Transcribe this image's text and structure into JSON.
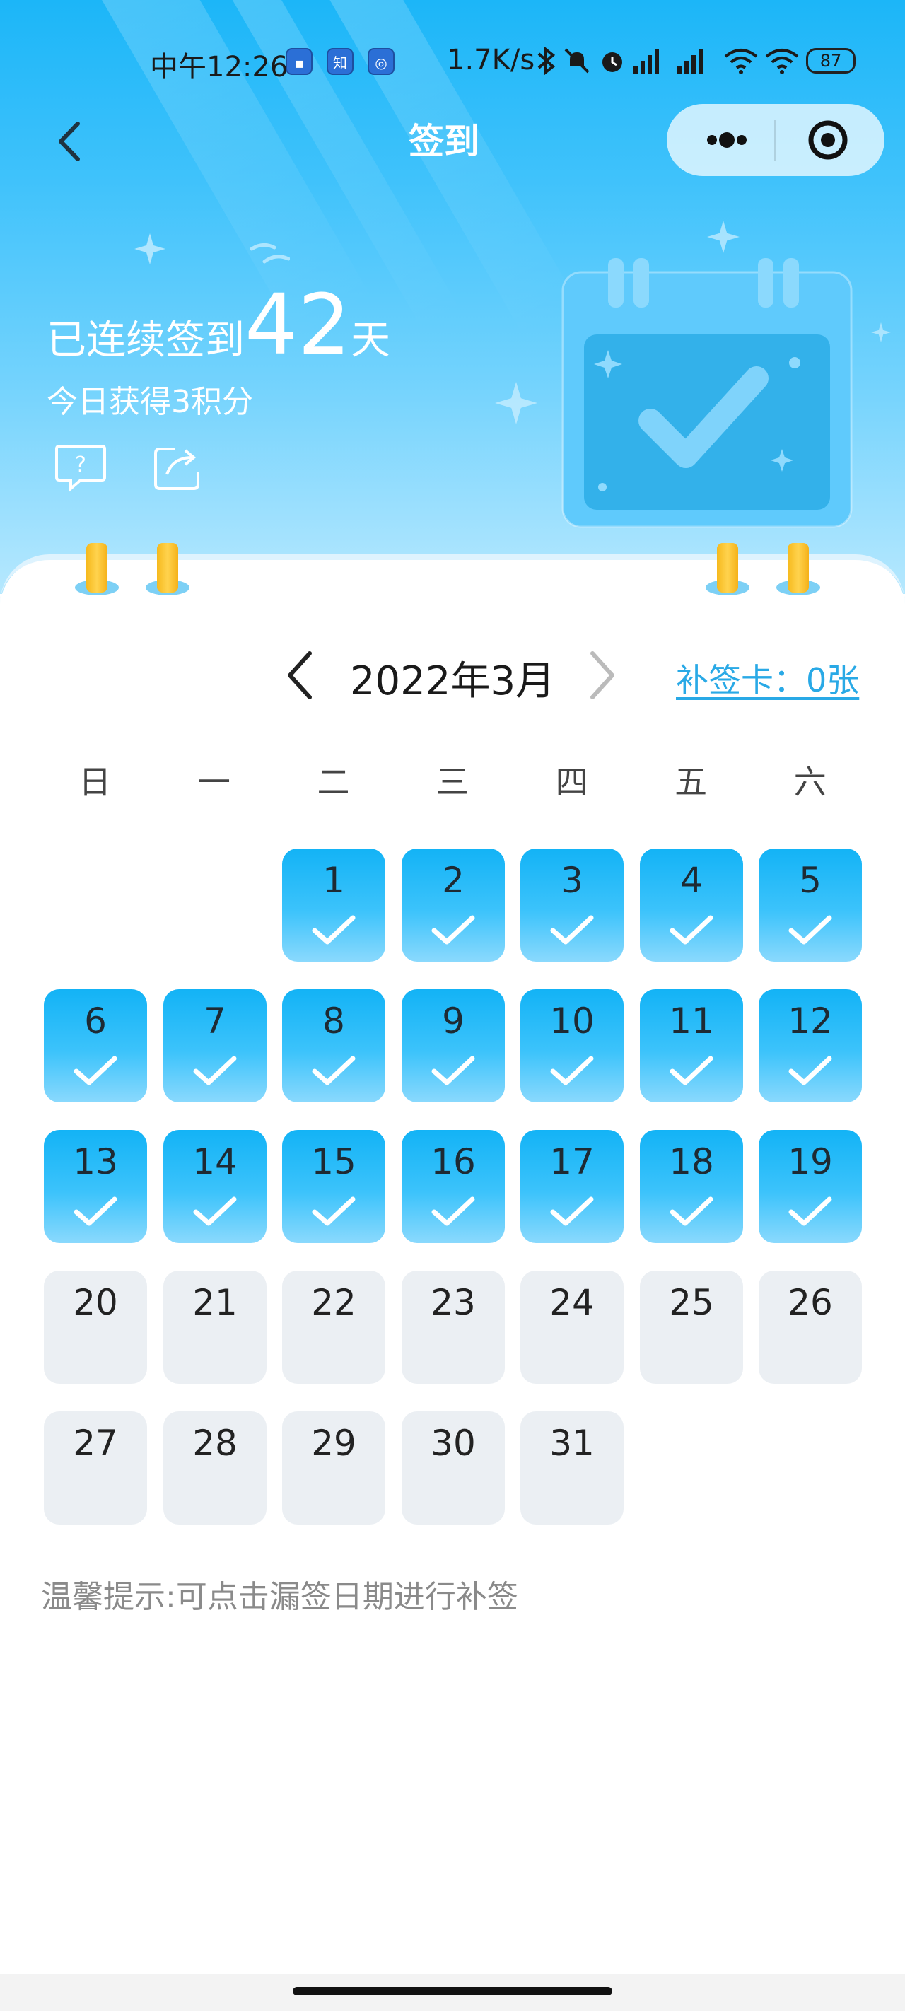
{
  "status_bar": {
    "time": "中午12:26",
    "badges": [
      "知"
    ],
    "network_speed": "1.7K/s",
    "battery": "87"
  },
  "nav": {
    "title": "签到",
    "back_icon": "chevron-left-icon",
    "more_icon": "more-dots-icon",
    "close_icon": "target-circle-icon"
  },
  "summary": {
    "streak_prefix": "已连续签到",
    "streak_days": "42",
    "streak_suffix": "天",
    "today_points": "今日获得3积分"
  },
  "calendar": {
    "month_label": "2022年3月",
    "makeup_card": "补签卡：0张",
    "weekdays": [
      "日",
      "一",
      "二",
      "三",
      "四",
      "五",
      "六"
    ],
    "first_weekday": 2,
    "days_in_month": 31,
    "signed_through": 19
  },
  "tip": "温馨提示:可点击漏签日期进行补签",
  "colors": {
    "accent": "#13b3f6",
    "link": "#29a9e6",
    "unsigned": "#ebeff3"
  }
}
